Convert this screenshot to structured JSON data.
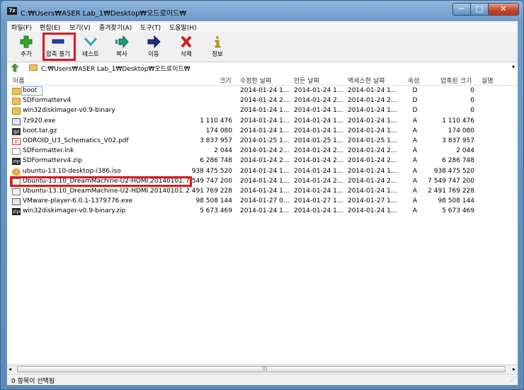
{
  "window": {
    "title": "C:₩Users₩ASER Lab_1₩Desktop₩오드로이드₩",
    "app_icon": "7z",
    "controls": {
      "minimize": "─",
      "maximize": "□",
      "close": "✕"
    }
  },
  "menu": [
    "파일(F)",
    "편집(E)",
    "보기(V)",
    "즐겨찾기(A)",
    "도구(T)",
    "도움말(H)"
  ],
  "toolbar": {
    "add": "추가",
    "extract": "압축 풀기",
    "test": "테스트",
    "copy": "복사",
    "move": "이동",
    "delete": "삭제",
    "info": "정보"
  },
  "address": {
    "path": "C:₩Users₩ASER Lab_1₩Desktop₩오드로이드₩",
    "dropdown": "▾"
  },
  "columns": {
    "name": "이름",
    "size": "크기",
    "modified": "수정한 날짜",
    "created": "만든 날짜",
    "accessed": "액세스한 날짜",
    "attributes": "속성",
    "packed": "압축된 크기",
    "comment": "설명"
  },
  "files": [
    {
      "icon": "folder-icon",
      "name": "boot",
      "size": "",
      "modified": "2014-01-24 1...",
      "created": "2014-01-24 1...",
      "accessed": "2014-01-24 1...",
      "attr": "D",
      "packed": "0"
    },
    {
      "icon": "folder-icon",
      "name": "SDFormatterv4",
      "size": "",
      "modified": "2014-01-24 2...",
      "created": "2014-01-24 2...",
      "accessed": "2014-01-24 2...",
      "attr": "D",
      "packed": "0"
    },
    {
      "icon": "folder-icon",
      "name": "win32diskimager-v0.9-binary",
      "size": "",
      "modified": "2014-01-24 1...",
      "created": "2014-01-24 1...",
      "accessed": "2014-01-24 1...",
      "attr": "D",
      "packed": "0"
    },
    {
      "icon": "exe-icon",
      "name": "7z920.exe",
      "size": "1 110 476",
      "modified": "2014-01-24 1...",
      "created": "2014-01-24 1...",
      "accessed": "2014-01-24 1...",
      "attr": "A",
      "packed": "1 110 476"
    },
    {
      "icon": "gz-icon",
      "name": "boot.tar.gz",
      "size": "174 080",
      "modified": "2014-01-24 1...",
      "created": "2014-01-24 1...",
      "accessed": "2014-01-24 1...",
      "attr": "A",
      "packed": "174 080"
    },
    {
      "icon": "pdf-icon",
      "name": "ODROID_U3_Schematics_V02.pdf",
      "size": "3 837 957",
      "modified": "2014-01-25 1...",
      "created": "2014-01-25 1...",
      "accessed": "2014-01-25 1...",
      "attr": "A",
      "packed": "3 837 957"
    },
    {
      "icon": "shortcut-icon",
      "name": "SDFormatter.lnk",
      "size": "2 044",
      "modified": "2014-01-24 2...",
      "created": "2014-01-24 2...",
      "accessed": "2014-01-24 2...",
      "attr": "A",
      "packed": "2 044"
    },
    {
      "icon": "zip-icon",
      "name": "SDFormatterv4.zip",
      "size": "6 286 748",
      "modified": "2014-01-24 2...",
      "created": "2014-01-24 2...",
      "accessed": "2014-01-24 2...",
      "attr": "A",
      "packed": "6 286 748"
    },
    {
      "icon": "iso-icon",
      "name": "ubuntu-13.10-desktop-i386.iso",
      "size": "938 475 520",
      "modified": "2014-01-24 1...",
      "created": "2014-01-24 1...",
      "accessed": "2014-01-24 1...",
      "attr": "A",
      "packed": "938 475 520"
    },
    {
      "icon": "disk-image-icon",
      "name": "Ubuntu-13.10_DreamMachine-U2-HDMI.20140101....",
      "size": "7 549 747 200",
      "modified": "2014-01-24 1...",
      "created": "2014-01-24 2...",
      "accessed": "2014-01-24 2...",
      "attr": "A",
      "packed": "7 549 747 200"
    },
    {
      "icon": "disk-image-icon",
      "name": "Ubuntu-13.10_DreamMachine-U2-HDMI.20140101....",
      "size": "2 491 769 228",
      "modified": "2014-01-24 1...",
      "created": "2014-01-24 1...",
      "accessed": "2014-01-24 1...",
      "attr": "A",
      "packed": "2 491 769 228"
    },
    {
      "icon": "exe-icon",
      "name": "VMware-player-6.0.1-1379776.exe",
      "size": "98 508 144",
      "modified": "2014-01-27 0...",
      "created": "2014-01-27 1...",
      "accessed": "2014-01-27 1...",
      "attr": "A",
      "packed": "98 508 144"
    },
    {
      "icon": "zip-icon",
      "name": "win32diskimager-v0.9-binary.zip",
      "size": "5 673 469",
      "modified": "2014-01-24 1...",
      "created": "2014-01-24 1...",
      "accessed": "2014-01-24 1...",
      "attr": "A",
      "packed": "5 673 469"
    }
  ],
  "scrollbar": {
    "left": "◂",
    "right": "▸",
    "grip": "⁞⁞⁞"
  },
  "status": "0 항목이 선택됨",
  "colors": {
    "highlight": "#e0161c",
    "folder": "#e9c35a"
  }
}
